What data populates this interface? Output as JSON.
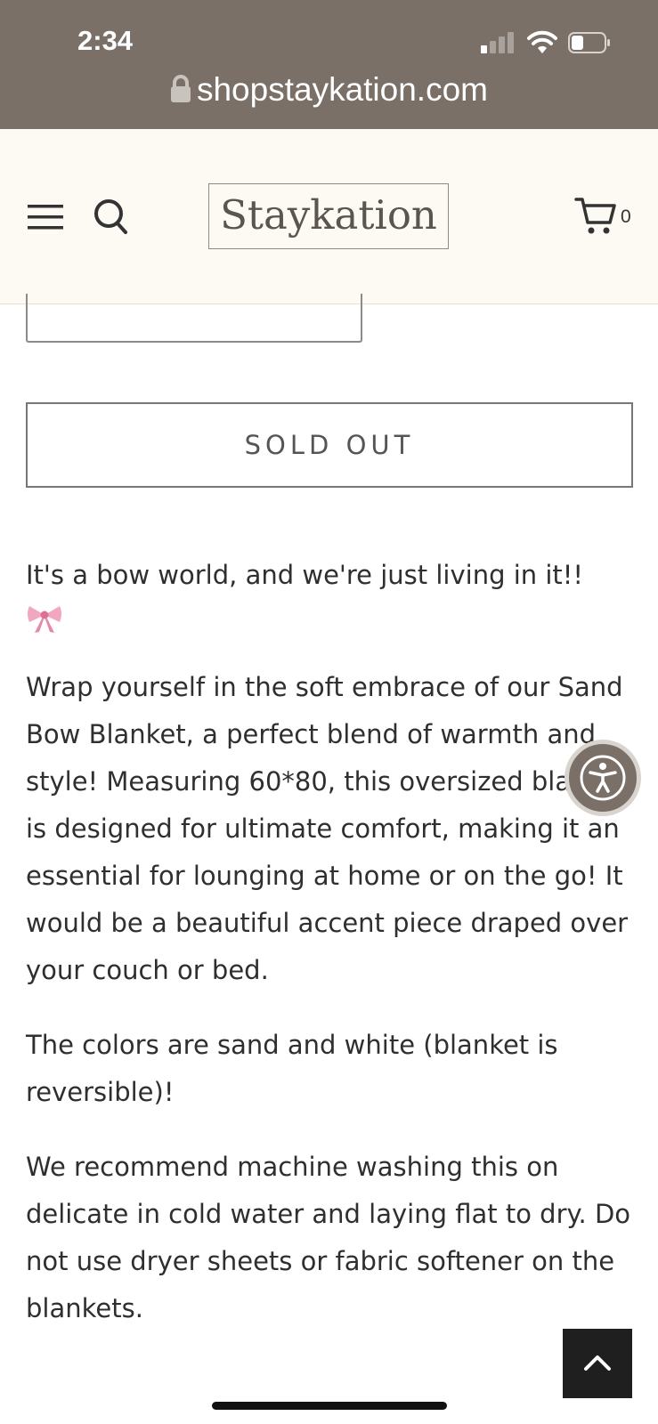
{
  "status_bar": {
    "time": "2:34",
    "signal_icon": "cellular-signal-icon",
    "wifi_icon": "wifi-icon",
    "battery_icon": "battery-icon",
    "battery_level": 0.3
  },
  "browser": {
    "lock_icon": "lock-icon",
    "url": "shopstaykation.com"
  },
  "header": {
    "menu_icon": "hamburger-menu-icon",
    "search_icon": "search-icon",
    "logo_text": "Staykation",
    "cart_icon": "cart-icon",
    "cart_count": "0",
    "background": "#fdf9f3"
  },
  "product": {
    "sold_out_label": "SOLD OUT",
    "description": [
      "It's a bow world, and we're just living in it!!",
      "Wrap yourself in the soft embrace of our Sand Bow Blanket, a perfect blend of warmth and style! Measuring 60*80, this oversized blanket is designed for ultimate comfort, making it an essential for lounging at home or on the go! It would be a beautiful accent piece draped over your couch or bed.",
      "The colors are sand and white (blanket is reversible)!",
      "We recommend machine washing this on delicate in cold water and laying flat to dry. Do not use dryer sheets or fabric softener on the blankets."
    ],
    "bow_icon": "ribbon-bow-icon"
  },
  "floating": {
    "accessibility_icon": "accessibility-icon",
    "back_to_top_icon": "chevron-up-icon"
  },
  "colors": {
    "brand": "#7a7068",
    "text": "#2f2f2f",
    "bow": "#f2a7c0"
  }
}
